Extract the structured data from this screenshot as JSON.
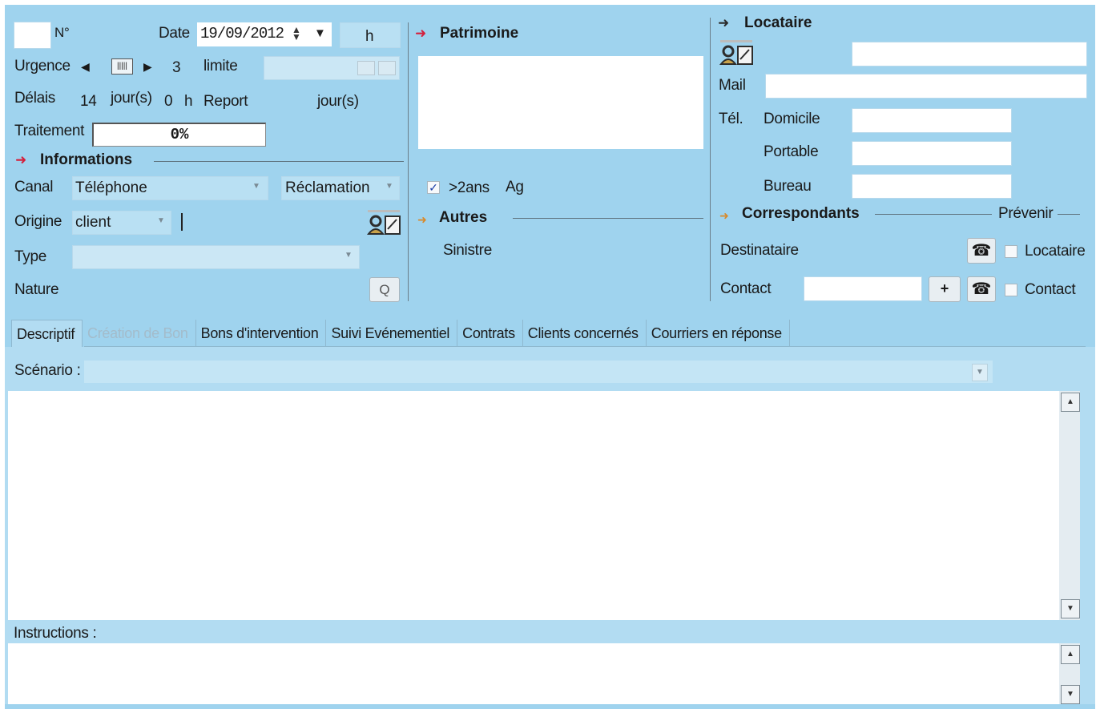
{
  "header": {
    "num_label": "N°",
    "date_label": "Date",
    "date_value": "19/09/2012",
    "hour_label": "h",
    "urgence_label": "Urgence",
    "urgence_value": "3",
    "limite_label": "limite",
    "delais_label": "Délais",
    "delais_days": "14",
    "delais_days_unit": "jour(s)",
    "delais_hours": "0",
    "delais_hours_unit": "h",
    "report_label": "Report",
    "report_unit": "jour(s)",
    "traitement_label": "Traitement",
    "traitement_value": "0%",
    "traitement_progress": 0
  },
  "informations": {
    "title": "Informations",
    "canal_label": "Canal",
    "canal_value": "Téléphone",
    "reclamation_value": "Réclamation",
    "origine_label": "Origine",
    "origine_value": "client",
    "type_label": "Type",
    "type_value": "",
    "nature_label": "Nature",
    "nature_button": "Q"
  },
  "patrimoine": {
    "title": "Patrimoine",
    "checkbox_label": ">2ans",
    "checkbox_checked": true,
    "ag_label": "Ag"
  },
  "autres": {
    "title": "Autres",
    "sinistre_label": "Sinistre"
  },
  "locataire": {
    "title": "Locataire",
    "mail_label": "Mail",
    "tel_label": "Tél.",
    "domicile_label": "Domicile",
    "portable_label": "Portable",
    "bureau_label": "Bureau"
  },
  "correspondants": {
    "title": "Correspondants",
    "prevenir_label": "Prévenir",
    "destinataire_label": "Destinataire",
    "contact_label": "Contact",
    "plus_button": "+",
    "cb_locataire_label": "Locataire",
    "cb_contact_label": "Contact"
  },
  "tabs": [
    {
      "label": "Descriptif",
      "state": "active"
    },
    {
      "label": "Création de Bon",
      "state": "disabled"
    },
    {
      "label": "Bons d'intervention",
      "state": "normal"
    },
    {
      "label": "Suivi Evénementiel",
      "state": "normal"
    },
    {
      "label": "Contrats",
      "state": "normal"
    },
    {
      "label": "Clients concernés",
      "state": "normal"
    },
    {
      "label": "Courriers en réponse",
      "state": "normal"
    }
  ],
  "descriptif": {
    "scenario_label": "Scénario :",
    "instructions_label": "Instructions :"
  },
  "colors": {
    "background": "#9fd3ee",
    "arrow_red": "#d4203c",
    "arrow_orange": "#d8892a",
    "arrow_dark": "#2b2b2b"
  }
}
